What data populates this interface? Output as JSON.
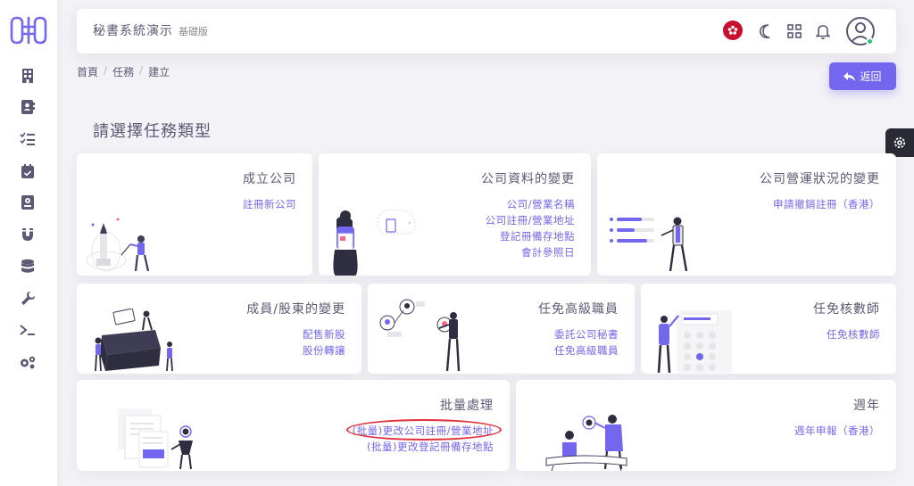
{
  "header": {
    "app_title": "秘書系統演示",
    "edition": "基礎版"
  },
  "breadcrumb": [
    "首頁",
    "任務",
    "建立"
  ],
  "back_button": "返回",
  "section_title": "請選擇任務類型",
  "colors": {
    "accent": "#7367f0",
    "text": "#5e5873",
    "online": "#28c76f",
    "flag": "#c8102e"
  },
  "sidebar": {
    "icons": [
      "building-icon",
      "contact-book-icon",
      "task-list-icon",
      "calendar-check-icon",
      "report-icon",
      "magnet-icon",
      "database-icon",
      "wrench-icon",
      "terminal-icon",
      "gears-icon"
    ]
  },
  "cards": [
    {
      "title": "成立公司",
      "links": [
        "註冊新公司"
      ]
    },
    {
      "title": "公司資料的變更",
      "links": [
        "公司/營業名稱",
        "公司註冊/營業地址",
        "登記冊備存地點",
        "會計參照日"
      ]
    },
    {
      "title": "公司營運狀況的變更",
      "links": [
        "申請撤銷註冊（香港）"
      ]
    },
    {
      "title": "成員/股東的變更",
      "links": [
        "配售新股",
        "股份轉讓"
      ]
    },
    {
      "title": "任免高級職員",
      "links": [
        "委託公司秘書",
        "任免高級職員"
      ]
    },
    {
      "title": "任免核數師",
      "links": [
        "任免核數師"
      ]
    },
    {
      "title": "批量處理",
      "links": [
        "(批量)更改公司註冊/營業地址",
        "(批量)更改登記冊備存地點"
      ]
    },
    {
      "title": "週年",
      "links": [
        "週年申報（香港）"
      ]
    }
  ]
}
